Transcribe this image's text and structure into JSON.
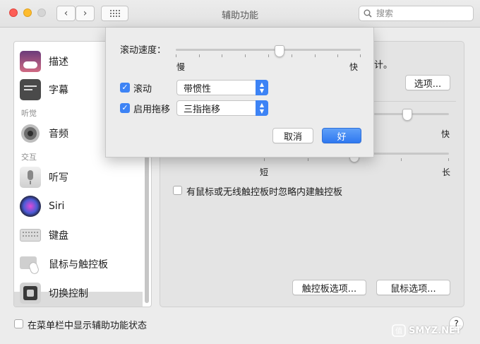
{
  "window": {
    "title": "辅助功能"
  },
  "search": {
    "placeholder": "搜索"
  },
  "sidebar": {
    "items": [
      {
        "label": "描述",
        "icon": "description-icon"
      },
      {
        "label": "字幕",
        "icon": "captions-icon"
      },
      {
        "label": "听觉",
        "type": "header"
      },
      {
        "label": "音频",
        "icon": "speaker-icon"
      },
      {
        "label": "交互",
        "type": "header"
      },
      {
        "label": "听写",
        "icon": "microphone-icon"
      },
      {
        "label": "Siri",
        "icon": "siri-icon"
      },
      {
        "label": "键盘",
        "icon": "keyboard-icon"
      },
      {
        "label": "鼠标与触控板",
        "icon": "mouse-trackpad-icon",
        "selected": true
      },
      {
        "label": "切换控制",
        "icon": "switch-control-icon"
      }
    ]
  },
  "main": {
    "partial_text": "计。",
    "options_button": "选项...",
    "slider1_fast": "快",
    "slider2_short": "短",
    "slider2_long": "长",
    "ignore_trackpad_label": "有鼠标或无线触控板时忽略内建触控板",
    "trackpad_options_button": "触控板选项...",
    "mouse_options_button": "鼠标选项..."
  },
  "sheet": {
    "scroll_speed_label": "滚动速度：",
    "slow_label": "慢",
    "fast_label": "快",
    "scroll_checkbox_label": "滚动",
    "scroll_popup_value": "带惯性",
    "drag_checkbox_label": "启用拖移",
    "drag_popup_value": "三指拖移",
    "cancel_button": "取消",
    "ok_button": "好"
  },
  "footer": {
    "menubar_checkbox_label": "在菜单栏中显示辅助功能状态",
    "help_button": "?"
  },
  "watermark": "SMYZ.NET",
  "colors": {
    "accent": "#3d83f5",
    "close": "#fd5f57",
    "minimize": "#febc2e",
    "zoom": "#d5d5d5"
  }
}
